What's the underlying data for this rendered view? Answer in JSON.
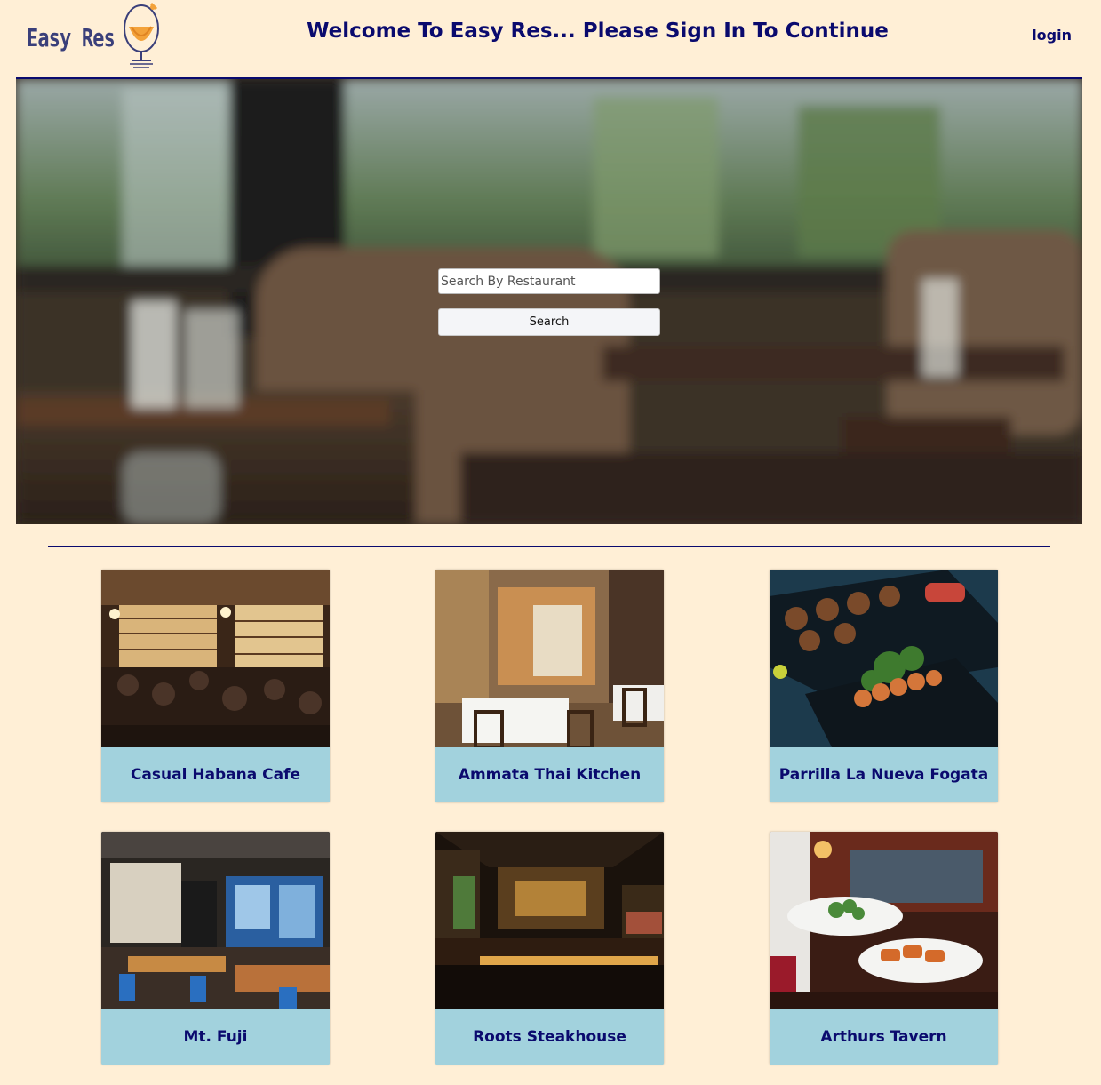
{
  "header": {
    "logo_text": "Easy Res",
    "title": "Welcome To Easy Res... Please Sign In To Continue",
    "login_label": "login"
  },
  "search": {
    "placeholder": "Search By Restaurant",
    "button_label": "Search"
  },
  "restaurants": [
    {
      "name": "Casual Habana Cafe",
      "image": "bar-interior-photo"
    },
    {
      "name": "Ammata Thai Kitchen",
      "image": "dining-room-photo"
    },
    {
      "name": "Parrilla La Nueva Fogata",
      "image": "skewers-plate-photo"
    },
    {
      "name": "Mt. Fuji",
      "image": "cafeteria-photo"
    },
    {
      "name": "Roots Steakhouse",
      "image": "steakhouse-bar-photo"
    },
    {
      "name": "Arthurs Tavern",
      "image": "waiter-plates-photo"
    }
  ],
  "colors": {
    "background": "#ffefd6",
    "accent": "#0a0a6e",
    "card_label_bg": "#a2d2dd"
  }
}
